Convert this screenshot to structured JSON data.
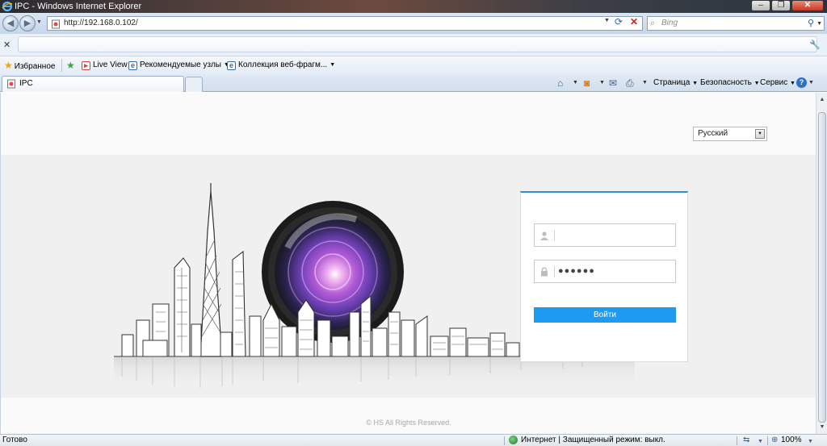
{
  "window": {
    "title": "IPC - Windows Internet Explorer",
    "min_symbol": "–",
    "max_symbol": "❐",
    "close_symbol": "✕"
  },
  "nav": {
    "back_symbol": "◀",
    "forward_symbol": "▶",
    "url": "http://192.168.0.102/",
    "search_placeholder": "Bing"
  },
  "favorites_bar": {
    "favorites_label": "Избранное",
    "items": [
      {
        "label": "Live View"
      },
      {
        "label": "Рекомендуемые узлы"
      },
      {
        "label": "Коллекция веб-фрагм..."
      }
    ]
  },
  "tabs": [
    {
      "label": "IPC"
    }
  ],
  "command_bar": {
    "page_label": "Страница",
    "safety_label": "Безопасность",
    "tools_label": "Сервис",
    "help_symbol": "?"
  },
  "page": {
    "language": "Русский",
    "username_value": "",
    "password_value": "●●●●●●",
    "login_button": "Войти",
    "copyright": "© HS  All Rights Reserved."
  },
  "status_bar": {
    "left_text": "Готово",
    "zone_text": "Интернет | Защищенный режим: выкл.",
    "zoom": "100%"
  },
  "colors": {
    "login_button": "#1e9af0",
    "card_accent": "#2e8fd6",
    "page_band": "#f0f0f0"
  },
  "icons": [
    "ie-logo-icon",
    "back-icon",
    "forward-icon",
    "refresh-icon",
    "stop-icon",
    "search-icon",
    "star-icon",
    "add-favorite-icon",
    "home-icon",
    "feeds-icon",
    "mail-icon",
    "print-icon",
    "help-icon",
    "user-icon",
    "lock-icon",
    "globe-icon",
    "zoom-icon"
  ]
}
